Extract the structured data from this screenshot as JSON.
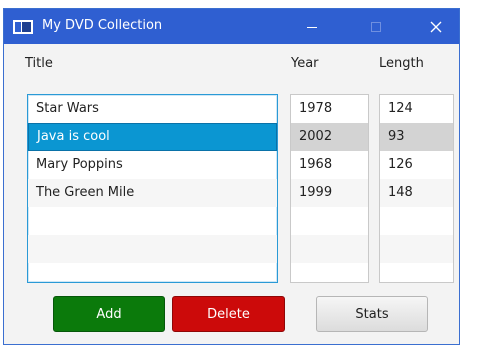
{
  "window": {
    "title": "My DVD Collection"
  },
  "headers": {
    "title": "Title",
    "year": "Year",
    "length": "Length"
  },
  "titles": [
    "Star Wars",
    "Java is cool",
    "Mary Poppins",
    "The Green Mile"
  ],
  "years": [
    "1978",
    "2002",
    "1968",
    "1999"
  ],
  "lengths": [
    "124",
    "93",
    "126",
    "148"
  ],
  "selected_index": 1,
  "buttons": {
    "add": "Add",
    "delete": "Delete",
    "stats": "Stats"
  },
  "colors": {
    "titlebar": "#2f5fd1",
    "selection": "#0b96d2",
    "add": "#0b7a0b",
    "delete": "#cc0a0a"
  },
  "icons": {
    "app": "window-icon",
    "minimize": "minimize-icon",
    "maximize": "maximize-icon",
    "close": "close-icon"
  }
}
